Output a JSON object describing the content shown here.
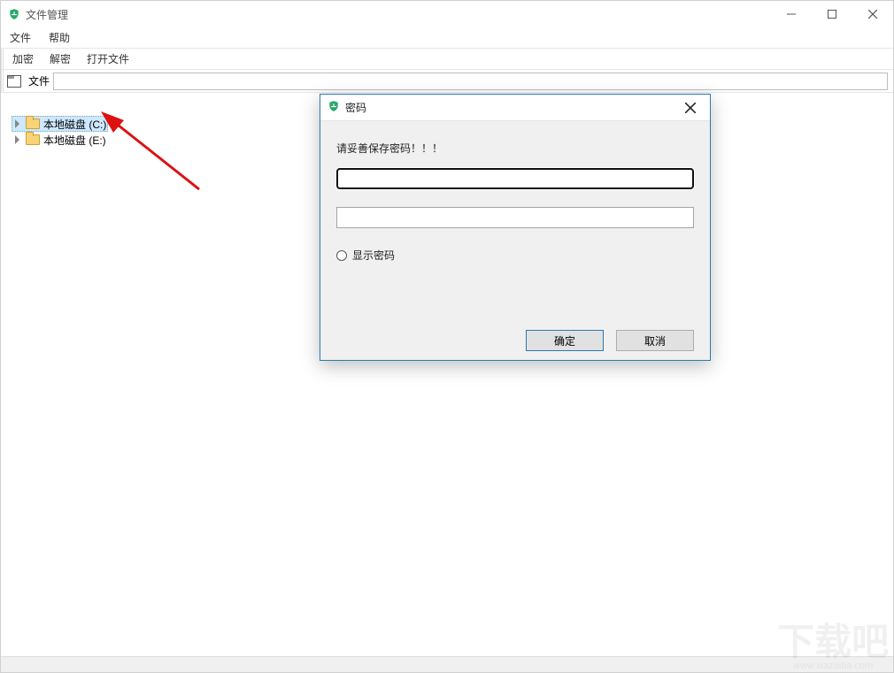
{
  "window": {
    "title": "文件管理"
  },
  "menubar": {
    "file": "文件",
    "help": "帮助"
  },
  "toolbar": {
    "encrypt": "加密",
    "decrypt": "解密",
    "open_file": "打开文件"
  },
  "pathbar": {
    "label": "文件",
    "value": ""
  },
  "tree": {
    "items": [
      {
        "label": "本地磁盘 (C:)",
        "selected": true
      },
      {
        "label": "本地磁盘 (E:)",
        "selected": false
      }
    ]
  },
  "dialog": {
    "title": "密码",
    "message": "请妥善保存密码！！！",
    "password1": "",
    "password2": "",
    "show_password_label": "显示密码",
    "ok": "确定",
    "cancel": "取消"
  },
  "watermark": {
    "text": "下载吧",
    "url": "www.xiazaiba.com"
  }
}
